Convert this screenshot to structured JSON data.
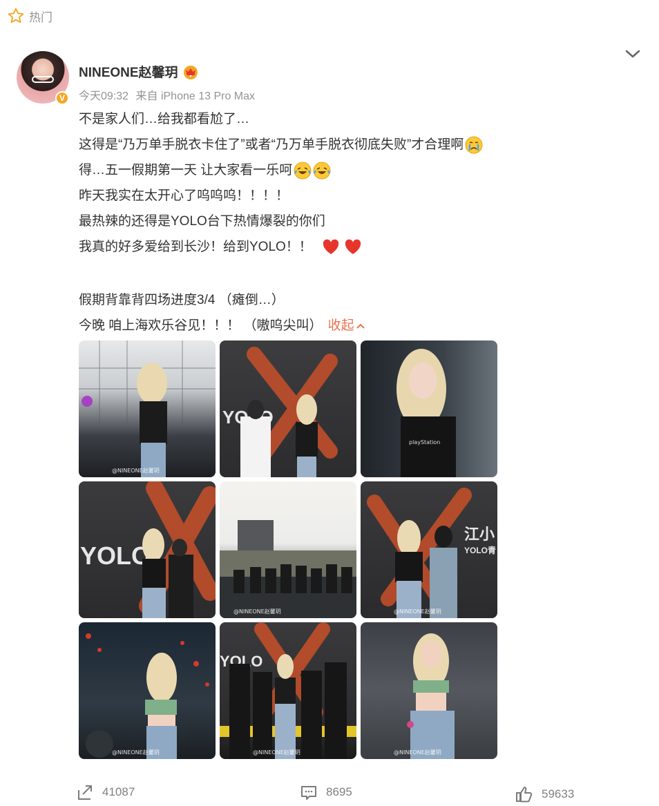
{
  "hot_label": "热门",
  "user": {
    "name": "NINEONE赵馨玥",
    "verified_badge": "V"
  },
  "meta": {
    "time": "今天09:32",
    "source": "来自 iPhone 13 Pro Max"
  },
  "post_lines": [
    "不是家人们…给我都看尬了…",
    "这得是“乃万单手脱衣卡住了”或者“乃万单手脱衣彻底失败”才合理啊",
    "得…五一假期第一天 让大家看一乐呵",
    "昨天我实在太开心了呜呜呜！！！！",
    "最热辣的还得是YOLO台下热情爆裂的你们",
    "我真的好多爱给到长沙！给到YOLO！！",
    "假期背靠背四场进度3/4 （瘫倒…）",
    "今晚 咱上海欢乐谷见！！！ （嗷呜尖叫）"
  ],
  "collapse_label": "收起",
  "watermark": "@NINEONE赵馨玥",
  "stats": {
    "reposts": "41087",
    "comments": "8695",
    "likes": "59633"
  },
  "colors": {
    "accent": "#eb7350",
    "muted": "#939393",
    "text": "#333333",
    "heart": "#e8352c"
  },
  "icons": [
    "star-icon",
    "chevron-down-icon",
    "crown-icon",
    "crying-emoji-icon",
    "laughing-emoji-icon",
    "heart-icon",
    "repost-icon",
    "comment-icon",
    "like-icon"
  ]
}
